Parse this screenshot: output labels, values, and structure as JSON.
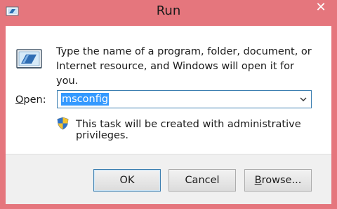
{
  "window": {
    "title": "Run",
    "close_glyph": "✕",
    "frame_color": "#e5767d"
  },
  "icons": {
    "title_icon": "run-icon",
    "app_icon": "run-icon",
    "close": "close-icon",
    "dropdown": "chevron-down-icon",
    "admin": "uac-shield-icon"
  },
  "content": {
    "description": "Type the name of a program, folder, document, or Internet resource, and Windows will open it for you.",
    "open_label_prefix": "O",
    "open_label_rest": "pen:",
    "open_value": "msconfig",
    "admin_note": "This task will be created with administrative privileges."
  },
  "buttons": {
    "ok_label": "OK",
    "cancel_label": "Cancel",
    "browse_prefix": "B",
    "browse_rest": "rowse..."
  },
  "colors": {
    "selection": "#3399ff",
    "focus_border": "#3c7fb1"
  }
}
